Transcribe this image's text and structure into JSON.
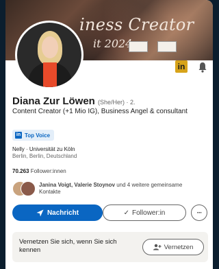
{
  "banner": {
    "line1": "iness Creator",
    "line2": "it 2024"
  },
  "profile": {
    "name": "Diana Zur Löwen",
    "pronoun_degree": "(She/Her) · 2.",
    "headline": "Content Creator (+1 Mio IG), Business Angel & consultant",
    "badge_label": "Top Voice",
    "education": "Nelly · Universität zu Köln",
    "location": "Berlin, Berlin, Deutschland",
    "followers_count": "70.263",
    "followers_label": " Follower:innen",
    "mutual_names": "Janina Voigt, Valerie Stoynov",
    "mutual_rest": " und 4 weitere gemeinsame Kontakte"
  },
  "actions": {
    "message_label": "Nachricht",
    "follow_label": "Follower:in",
    "more_label": "···"
  },
  "connect": {
    "prompt": "Vernetzen Sie sich, wenn Sie sich kennen",
    "button_label": "Vernetzen"
  },
  "icons": {
    "linkedin_badge": "in",
    "topvoice_icon": "in"
  },
  "colors": {
    "accent": "#0a66c2",
    "badge_gold": "#d7a31a"
  }
}
